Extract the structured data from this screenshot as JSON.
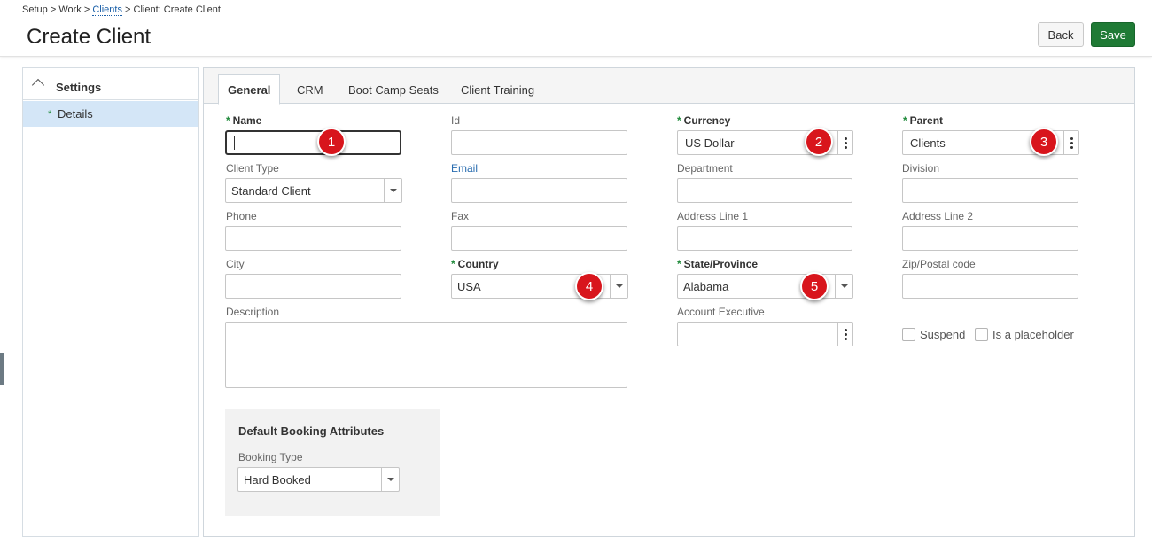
{
  "breadcrumb": {
    "setup": "Setup",
    "sep1": ">",
    "work": "Work",
    "sep2": ">",
    "clients": "Clients",
    "sep3": ">",
    "current": "Client: Create Client"
  },
  "page": {
    "title": "Create Client"
  },
  "toolbar": {
    "back_label": "Back",
    "save_label": "Save"
  },
  "sidebar": {
    "section_title": "Settings",
    "items": [
      {
        "label": "Details",
        "required_marker": "*"
      }
    ]
  },
  "tabs": [
    {
      "label": "General",
      "active": true
    },
    {
      "label": "CRM",
      "active": false
    },
    {
      "label": "Boot Camp Seats",
      "active": false
    },
    {
      "label": "Client Training",
      "active": false
    }
  ],
  "form": {
    "required_marker": "*",
    "name": {
      "label": "Name",
      "value": ""
    },
    "id": {
      "label": "Id",
      "value": ""
    },
    "currency": {
      "label": "Currency",
      "value": "US Dollar"
    },
    "parent": {
      "label": "Parent",
      "value": "Clients"
    },
    "client_type": {
      "label": "Client Type",
      "value": "Standard Client"
    },
    "email": {
      "label": "Email",
      "value": ""
    },
    "department": {
      "label": "Department",
      "value": ""
    },
    "division": {
      "label": "Division",
      "value": ""
    },
    "phone": {
      "label": "Phone",
      "value": ""
    },
    "fax": {
      "label": "Fax",
      "value": ""
    },
    "address1": {
      "label": "Address Line 1",
      "value": ""
    },
    "address2": {
      "label": "Address Line 2",
      "value": ""
    },
    "city": {
      "label": "City",
      "value": ""
    },
    "country": {
      "label": "Country",
      "value": "USA"
    },
    "state": {
      "label": "State/Province",
      "value": "Alabama"
    },
    "zip": {
      "label": "Zip/Postal code",
      "value": ""
    },
    "description": {
      "label": "Description",
      "value": ""
    },
    "account_exec": {
      "label": "Account Executive",
      "value": ""
    },
    "suspend": {
      "label": "Suspend",
      "checked": false
    },
    "placeholder": {
      "label": "Is a placeholder",
      "checked": false
    },
    "booking": {
      "section_title": "Default Booking Attributes",
      "type_label": "Booking Type",
      "type_value": "Hard Booked"
    }
  },
  "annotations": [
    "1",
    "2",
    "3",
    "4",
    "5"
  ],
  "colors": {
    "save_button": "#1f7a35",
    "selected_sidebar": "#d4e6f7",
    "required_star": "#1f8a3a",
    "badge": "#d8151c",
    "link": "#1a5fa8"
  }
}
